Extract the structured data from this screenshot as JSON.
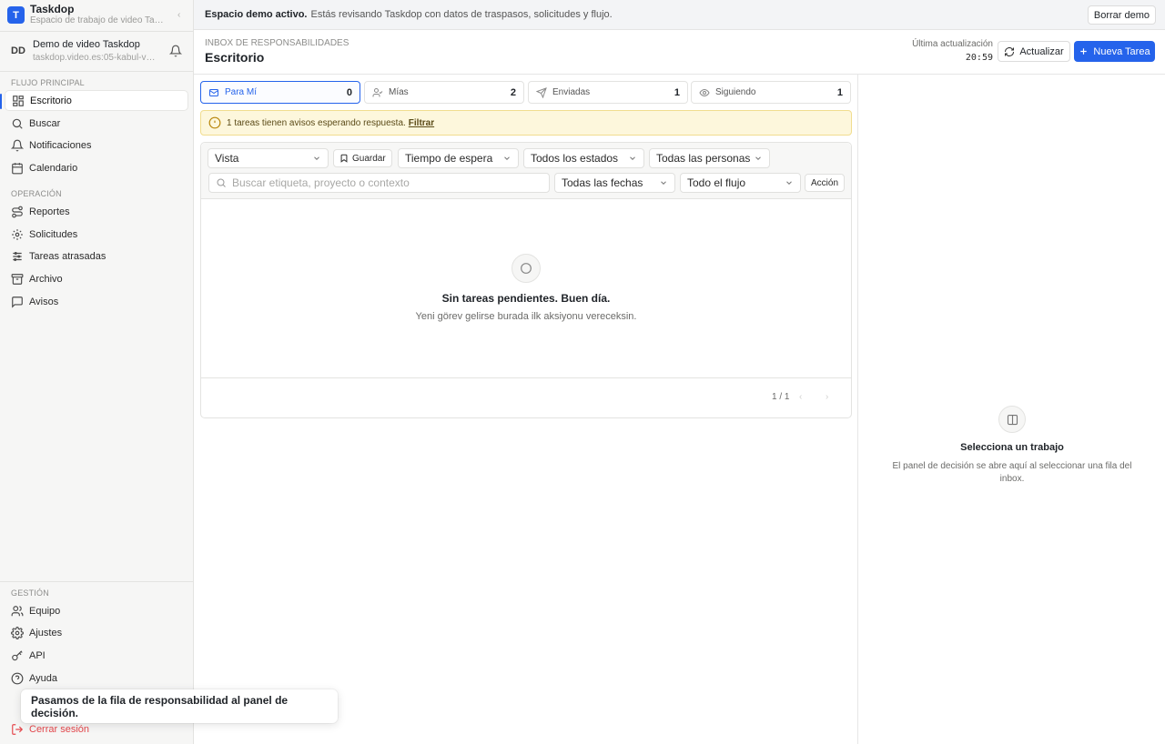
{
  "brand": {
    "logo_letter": "T",
    "name": "Taskdop",
    "subtitle": "Espacio de trabajo de video Ta…"
  },
  "workspace": {
    "initials": "DD",
    "name": "Demo de video Taskdop",
    "url": "taskdop.video.es:05-kabul-v…"
  },
  "sidebar": {
    "section_main": "FLUJO PRINCIPAL",
    "main_items": [
      {
        "label": "Escritorio",
        "icon": "grid-icon",
        "active": true
      },
      {
        "label": "Buscar",
        "icon": "search-icon"
      },
      {
        "label": "Notificaciones",
        "icon": "bell-icon"
      },
      {
        "label": "Calendario",
        "icon": "calendar-icon"
      }
    ],
    "section_ops": "OPERACIÓN",
    "ops_items": [
      {
        "label": "Reportes",
        "icon": "route-icon"
      },
      {
        "label": "Solicitudes",
        "icon": "settings-burst-icon"
      },
      {
        "label": "Tareas atrasadas",
        "icon": "sliders-icon"
      },
      {
        "label": "Archivo",
        "icon": "archive-icon"
      },
      {
        "label": "Avisos",
        "icon": "message-icon"
      }
    ],
    "section_mgmt": "GESTIÓN",
    "mgmt_items": [
      {
        "label": "Equipo",
        "icon": "users-icon"
      },
      {
        "label": "Ajustes",
        "icon": "gear-icon"
      },
      {
        "label": "API",
        "icon": "key-icon"
      },
      {
        "label": "Ayuda",
        "icon": "help-icon"
      }
    ],
    "logout": "Cerrar sesión"
  },
  "banner": {
    "bold": "Espacio demo activo.",
    "text": "Estás revisando Taskdop con datos de traspasos, solicitudes y flujo.",
    "clear_button": "Borrar demo"
  },
  "header": {
    "kicker": "INBOX DE RESPONSABILIDADES",
    "title": "Escritorio",
    "last_update_label": "Última actualización",
    "last_update_time": "20:59",
    "refresh_button": "Actualizar",
    "new_button": "Nueva Tarea"
  },
  "tabs": [
    {
      "label": "Para Mí",
      "count": "0",
      "icon": "inbox-icon",
      "active": true
    },
    {
      "label": "Mías",
      "count": "2",
      "icon": "user-check-icon"
    },
    {
      "label": "Enviadas",
      "count": "1",
      "icon": "send-icon"
    },
    {
      "label": "Siguiendo",
      "count": "1",
      "icon": "eye-icon"
    }
  ],
  "alert": {
    "text": "1 tareas tienen avisos esperando respuesta.",
    "link": "Filtrar"
  },
  "filters": {
    "view": "Vista",
    "save": "Guardar",
    "wait_time": "Tiempo de espera",
    "states": "Todos los estados",
    "people": "Todas las personas",
    "search_placeholder": "Buscar etiqueta, proyecto o contexto",
    "search_value": "",
    "dates": "Todas las fechas",
    "flow": "Todo el flujo",
    "action": "Acción"
  },
  "empty": {
    "title": "Sin tareas pendientes. Buen día.",
    "subtitle": "Yeni görev gelirse burada ilk aksiyonu vereceksin."
  },
  "pager": {
    "text": "1 / 1",
    "prev": "‹",
    "next": "›"
  },
  "detail": {
    "title": "Selecciona un trabajo",
    "subtitle": "El panel de decisión se abre aquí al seleccionar una fila del inbox."
  },
  "toast": {
    "text": "Pasamos de la fila de responsabilidad al panel de decisión."
  },
  "colors": {
    "accent": "#2563eb",
    "warning_bg": "#fdf7dc",
    "danger": "#e5484d"
  }
}
